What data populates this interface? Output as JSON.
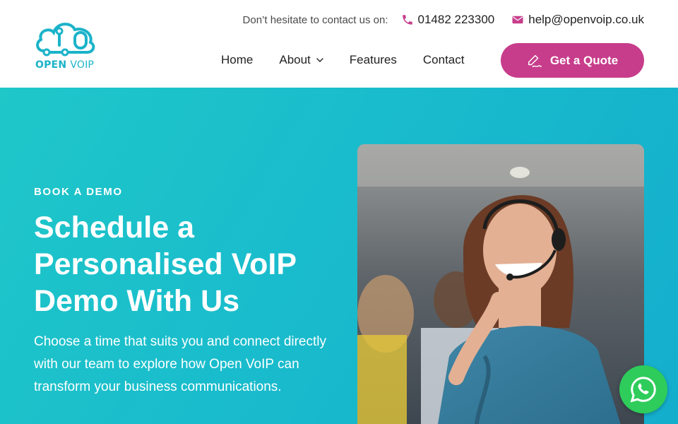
{
  "brand": {
    "logo_word_1": "OPEN",
    "logo_word_2": "VOIP",
    "accent_color": "#c73d8b",
    "teal_color": "#1bb3c9"
  },
  "header": {
    "contact_lead": "Don’t hesitate to contact us on:",
    "phone": "01482 223300",
    "email": "help@openvoip.co.uk"
  },
  "nav": {
    "items": [
      {
        "label": "Home",
        "icon": null
      },
      {
        "label": "About",
        "icon": "chevron-down-icon"
      },
      {
        "label": "Features",
        "icon": null
      },
      {
        "label": "Contact",
        "icon": null
      }
    ],
    "cta_label": "Get a Quote",
    "cta_icon": "signature-icon"
  },
  "hero": {
    "eyebrow": "BOOK A DEMO",
    "title": "Schedule a Personalised VoIP Demo With Us",
    "description": "Choose a time that suits you and connect directly with our team to explore how Open VoIP can transform your business communications.",
    "image_icon": "call-centre-agent-photo"
  },
  "floating": {
    "whatsapp_icon": "whatsapp-icon"
  }
}
